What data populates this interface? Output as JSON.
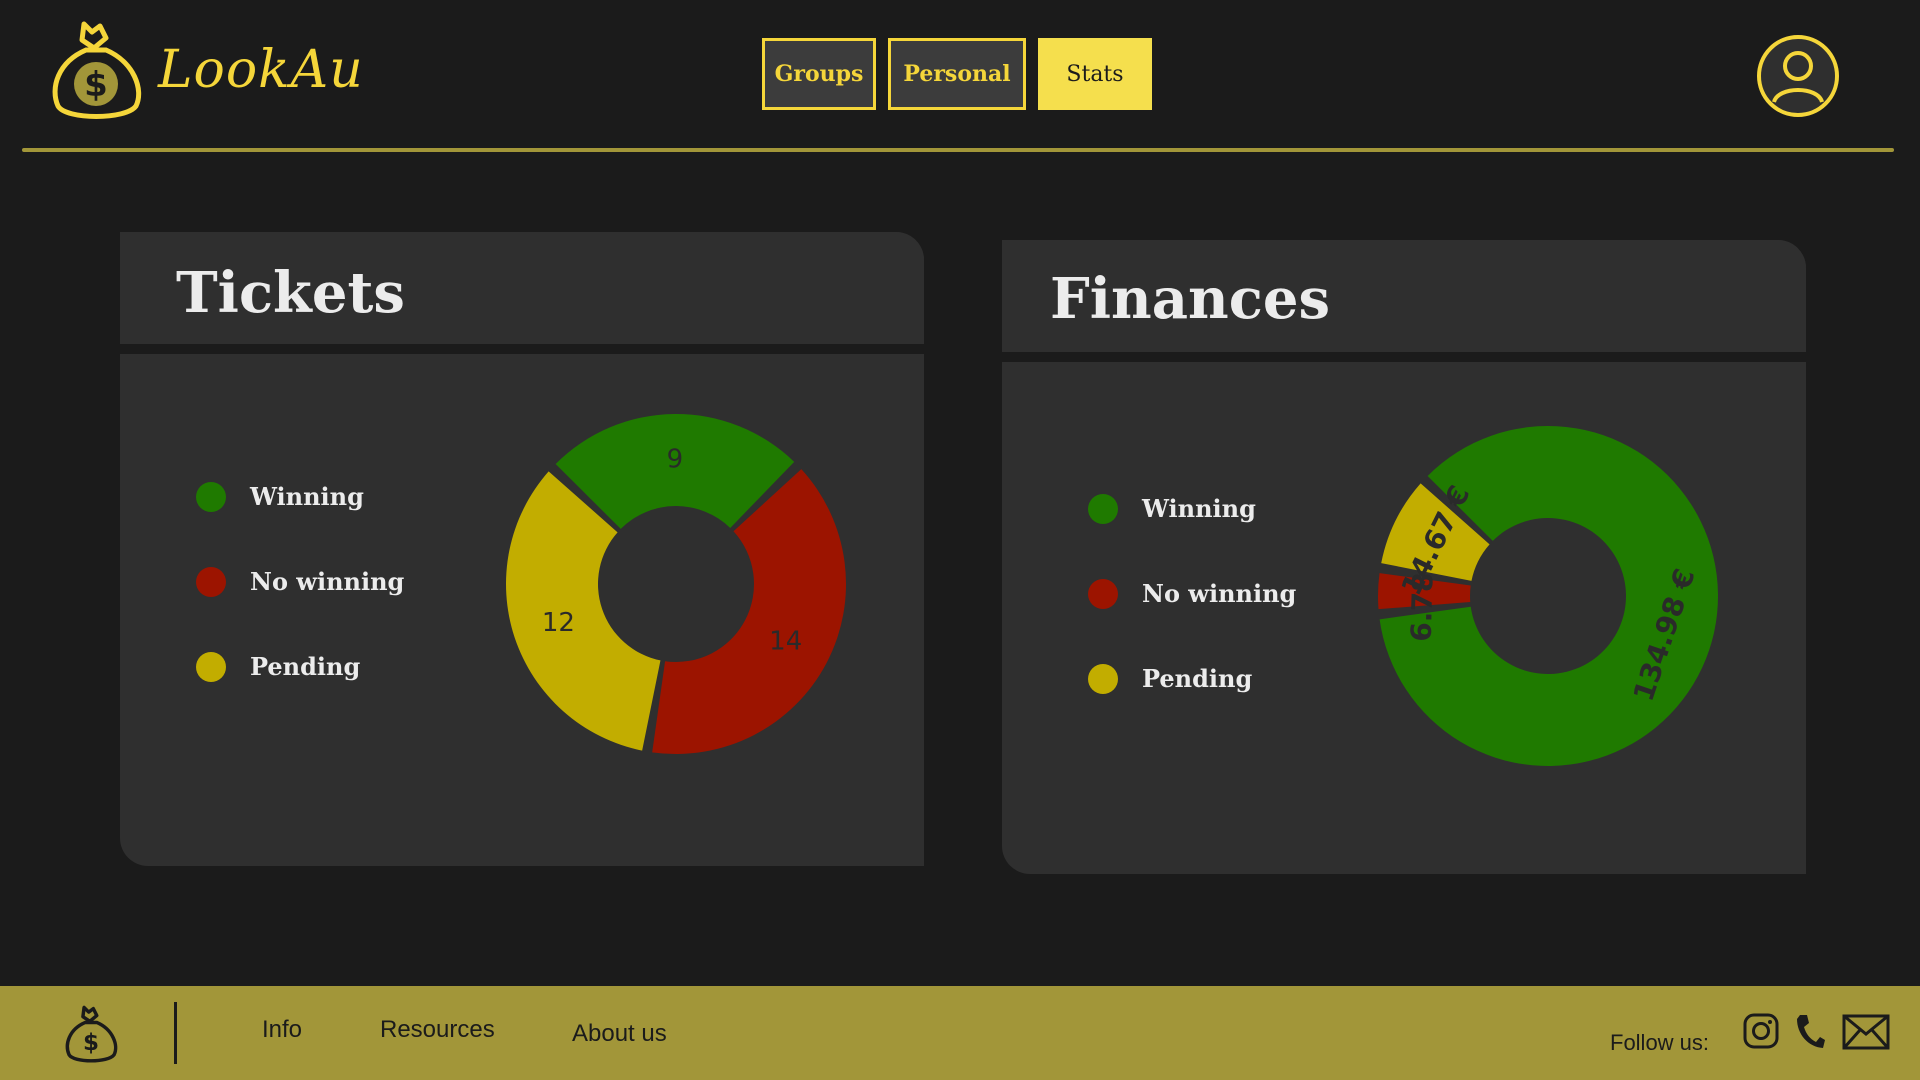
{
  "brand": {
    "name": "LookAu",
    "color": "#f5d63a"
  },
  "nav": {
    "items": [
      {
        "label": "Groups",
        "active": false
      },
      {
        "label": "Personal",
        "active": false
      },
      {
        "label": "Stats",
        "active": true
      }
    ]
  },
  "colors": {
    "winning": "#1f7a00",
    "no_winning": "#9c1400",
    "pending": "#c2ad00",
    "accent": "#f5d63a",
    "footer": "#a29639"
  },
  "tickets": {
    "title": "Tickets",
    "legend": [
      "Winning",
      "No winning",
      "Pending"
    ],
    "chart_data": {
      "type": "pie",
      "categories": [
        "Winning",
        "No winning",
        "Pending"
      ],
      "values": [
        9,
        14,
        12
      ],
      "labels": [
        "9",
        "14",
        "12"
      ]
    }
  },
  "finances": {
    "title": "Finances",
    "legend": [
      "Winning",
      "No winning",
      "Pending"
    ],
    "chart_data": {
      "type": "pie",
      "categories": [
        "Winning",
        "No winning",
        "Pending"
      ],
      "values": [
        134.98,
        6.78,
        14.67
      ],
      "labels": [
        "134.98 €",
        "6.78 €",
        "14.67 €"
      ]
    }
  },
  "footer": {
    "links": [
      "Info",
      "Resources",
      "About us"
    ],
    "follow_label": "Follow  us:",
    "social_icons": [
      "instagram-icon",
      "phone-icon",
      "mail-icon"
    ]
  }
}
